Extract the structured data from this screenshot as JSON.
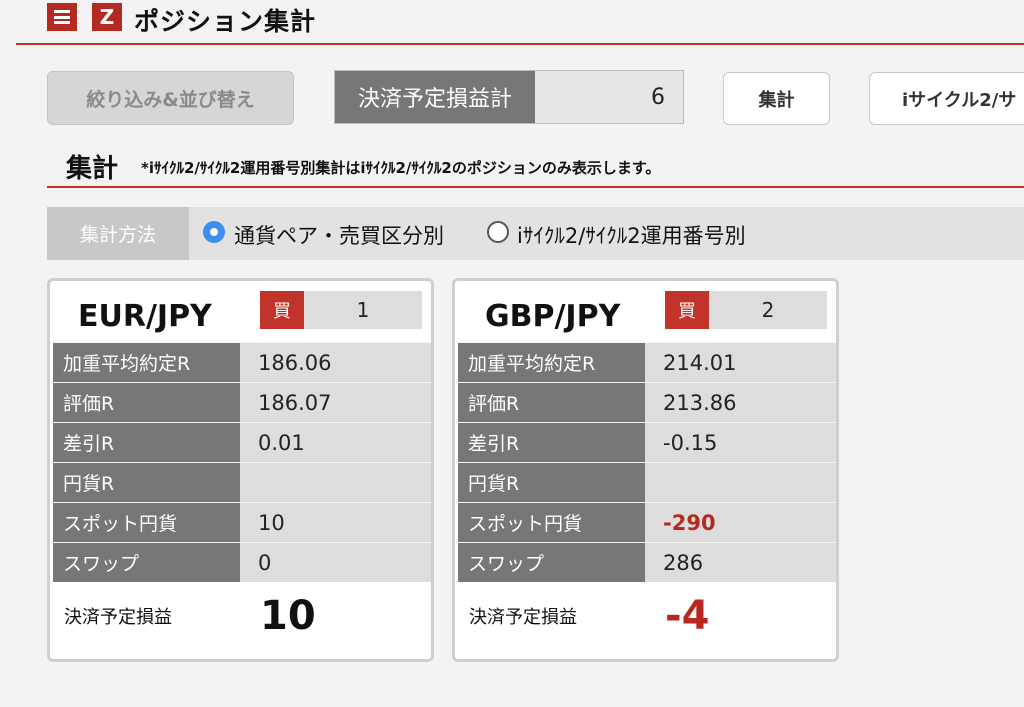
{
  "header": {
    "title": "ポジション集計",
    "menu_icon": "menu-icon",
    "logo_icon": "logo-z-icon",
    "logo_glyph": "Z"
  },
  "toolbar": {
    "filter_label": "絞り込み&並び替え",
    "total_label": "決済予定損益計",
    "total_value": "6",
    "aggregate_label": "集計",
    "cycle_label": "iサイクル2/サ"
  },
  "section": {
    "title": "集計",
    "note": "*iｻｲｸﾙ2/ｻｲｸﾙ2運用番号別集計はiｻｲｸﾙ2/ｻｲｸﾙ2のポジションのみ表示します。"
  },
  "method": {
    "label": "集計方法",
    "options": [
      {
        "label": "通貨ペア・売買区分別",
        "selected": true
      },
      {
        "label": "iｻｲｸﾙ2/ｻｲｸﾙ2運用番号別",
        "selected": false
      }
    ]
  },
  "cards": [
    {
      "pair": "EUR/JPY",
      "side": "買",
      "count": "1",
      "rows": [
        {
          "label": "加重平均約定R",
          "value": "186.06"
        },
        {
          "label": "評価R",
          "value": "186.07"
        },
        {
          "label": "差引R",
          "value": "0.01"
        },
        {
          "label": "円貨R",
          "value": ""
        },
        {
          "label": "スポット円貨",
          "value": "10"
        },
        {
          "label": "スワップ",
          "value": "0"
        }
      ],
      "pl_label": "決済予定損益",
      "pl_value": "10"
    },
    {
      "pair": "GBP/JPY",
      "side": "買",
      "count": "2",
      "rows": [
        {
          "label": "加重平均約定R",
          "value": "214.01"
        },
        {
          "label": "評価R",
          "value": "213.86"
        },
        {
          "label": "差引R",
          "value": "-0.15"
        },
        {
          "label": "円貨R",
          "value": ""
        },
        {
          "label": "スポット円貨",
          "value": "-290"
        },
        {
          "label": "スワップ",
          "value": "286"
        }
      ],
      "pl_label": "決済予定損益",
      "pl_value": "-4"
    }
  ],
  "colors": {
    "accent": "#c0342c",
    "negative": "#b8281f",
    "radio_selected": "#3d8ef0"
  }
}
